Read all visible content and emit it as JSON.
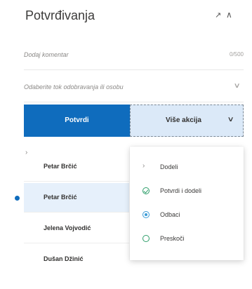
{
  "header": {
    "title": "Potvrđivanja",
    "edit_icon": "pencil-icon",
    "collapse_icon": "chevron-up-icon"
  },
  "comment": {
    "placeholder": "Dodaj komentar",
    "counter": "0/500"
  },
  "flow_select": {
    "placeholder": "Odaberite tok odobravanja ili osobu"
  },
  "actions": {
    "approve_label": "Potvrdi",
    "more_label": "Više akcija"
  },
  "approvers": [
    {
      "name": "Petar Brčić"
    },
    {
      "name": "Petar Brčić"
    },
    {
      "name": "Jelena Vojvodić"
    },
    {
      "name": "Dušan Džinić"
    }
  ],
  "more_menu": [
    {
      "label": "Dodeli",
      "icon": "chevron-right-icon"
    },
    {
      "label": "Potvrdi i dodeli",
      "icon": "check-circle-icon"
    },
    {
      "label": "Odbaci",
      "icon": "reject-circle-icon"
    },
    {
      "label": "Preskoči",
      "icon": "skip-circle-icon"
    }
  ],
  "colors": {
    "accent": "#0f6cbd",
    "selected_bg": "#e6f0fb",
    "more_button_bg": "#dbe9f8"
  }
}
